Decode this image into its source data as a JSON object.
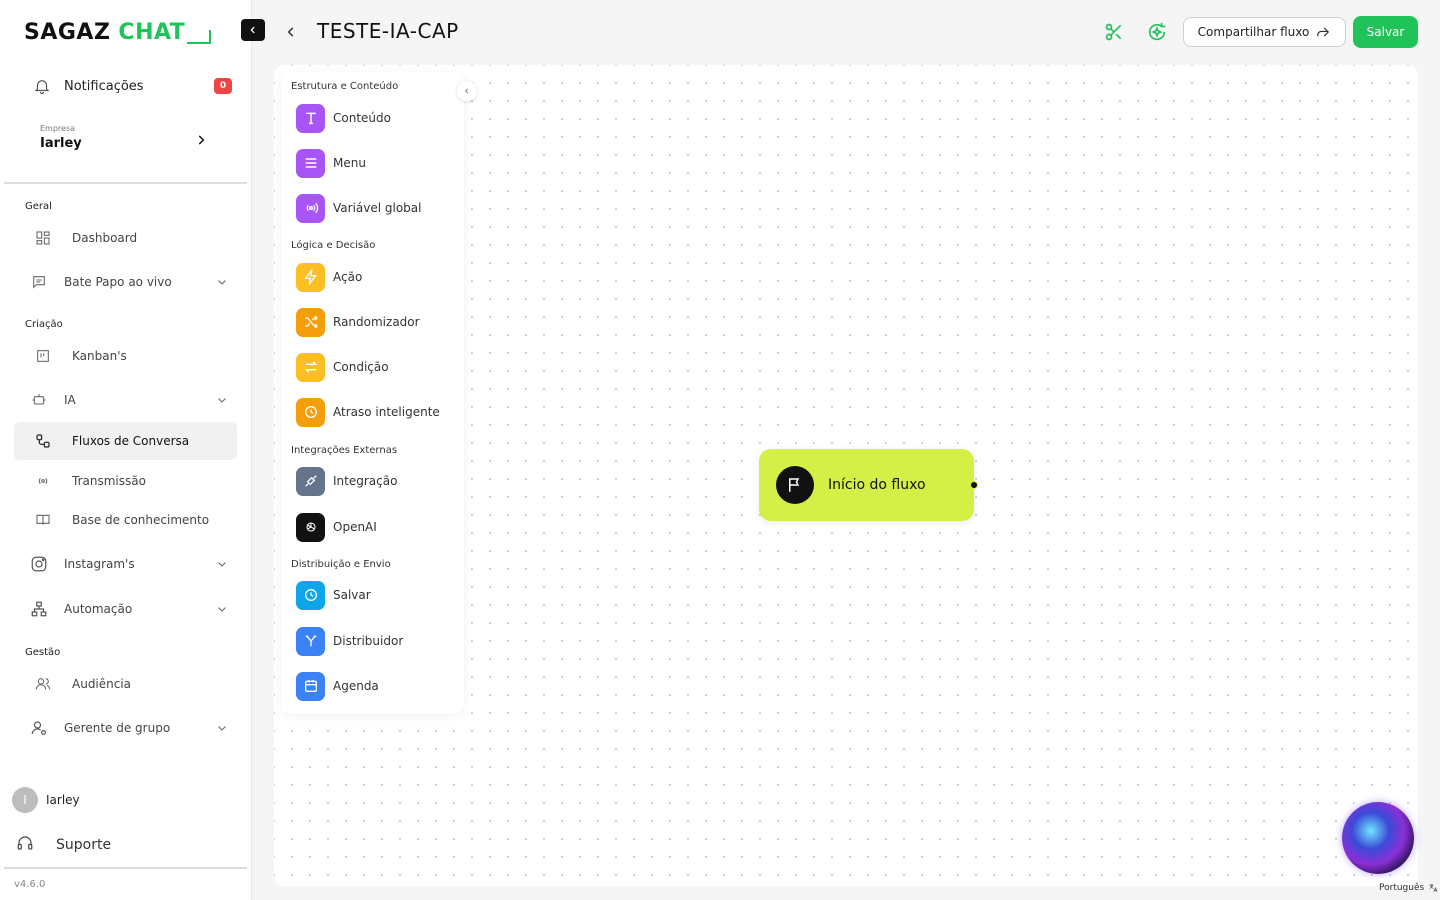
{
  "brand": {
    "name_part1": "SAGAZ",
    "name_part2": "CHAT",
    "accent": "#1fc35a"
  },
  "sidebar": {
    "notifications": {
      "label": "Notificações",
      "count": "0"
    },
    "company": {
      "caption": "Empresa",
      "name": "Iarley"
    },
    "sections": {
      "geral": "Geral",
      "criacao": "Criação",
      "gestao": "Gestão"
    },
    "items": {
      "dashboard": "Dashboard",
      "bate_papo": "Bate Papo ao vivo",
      "kanbans": "Kanban's",
      "ia": "IA",
      "fluxos": "Fluxos de Conversa",
      "transmissao": "Transmissão",
      "base": "Base de conhecimento",
      "instagram": "Instagram's",
      "automacao": "Automação",
      "audiencia": "Audiência",
      "gerente": "Gerente de grupo"
    },
    "user": {
      "initial": "I",
      "name": "Iarley"
    },
    "support": "Suporte",
    "version": "v4.6.0"
  },
  "header": {
    "title": "TESTE-IA-CAP",
    "share_label": "Compartilhar fluxo",
    "save_label": "Salvar"
  },
  "palette": {
    "sections": {
      "estrutura": "Estrutura e Conteúdo",
      "logica": "Lógica e Decisão",
      "integracoes": "Integrações Externas",
      "distribuicao": "Distribuição e Envio"
    },
    "items": {
      "conteudo": "Conteúdo",
      "menu": "Menu",
      "variavel": "Variável global",
      "acao": "Ação",
      "randomizador": "Randomizador",
      "condicao": "Condição",
      "atraso": "Atraso inteligente",
      "integracao": "Integração",
      "openai": "OpenAI",
      "salvar": "Salvar",
      "distribuidor": "Distribuidor",
      "agenda": "Agenda"
    },
    "colors": {
      "purple": "#a855f7",
      "amber": "#fbbf24",
      "orange": "#f59e0b",
      "slate": "#64748b",
      "black": "#111111",
      "blue": "#0ea5e9",
      "royal": "#3b82f6"
    }
  },
  "canvas": {
    "start_node": "Início do fluxo",
    "node_color": "#d4ef45"
  },
  "footer": {
    "language": "Português"
  }
}
